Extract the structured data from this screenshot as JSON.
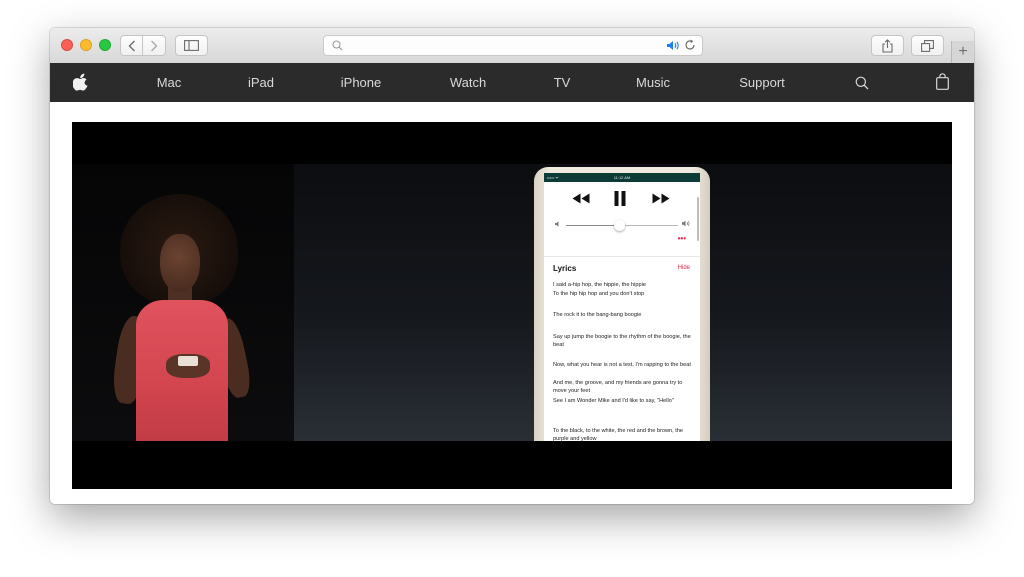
{
  "browser": {
    "address_text": "",
    "icons": [
      "back-icon",
      "forward-icon",
      "sidebar-icon",
      "search-icon",
      "audio-playing-icon",
      "reload-icon",
      "share-icon",
      "tabs-overview-icon",
      "new-tab-icon"
    ],
    "new_tab_glyph": "+"
  },
  "nav": {
    "items": [
      {
        "label": "Mac"
      },
      {
        "label": "iPad"
      },
      {
        "label": "iPhone"
      },
      {
        "label": "Watch"
      },
      {
        "label": "TV"
      },
      {
        "label": "Music"
      },
      {
        "label": "Support"
      }
    ],
    "background": "#2b2b2b",
    "text_color": "#d9d9d9"
  },
  "iphone": {
    "status": {
      "carrier": "••••• ᯤ",
      "time": "11:12 AM"
    },
    "volume_level": 0.48,
    "more_label": "•••",
    "lyrics_title": "Lyrics",
    "hide_label": "Hide",
    "accent_color": "#e0254a",
    "lyrics": [
      "I said a-hip hop, the hippie, the hippie",
      "To the hip hip hop and you don't stop",
      "The rock it to the bang-bang boogie",
      "Say up jump the boogie to the rhythm of the boogie, the beat",
      "Now, what you hear is not a test, I'm rapping to the beat",
      "And me, the groove, and my friends are gonna try to move your feet",
      "See I am Wonder Mike and I'd like to say, \"Hello\"",
      "To the black, to the white, the red and the brown, the purple and yellow"
    ]
  }
}
